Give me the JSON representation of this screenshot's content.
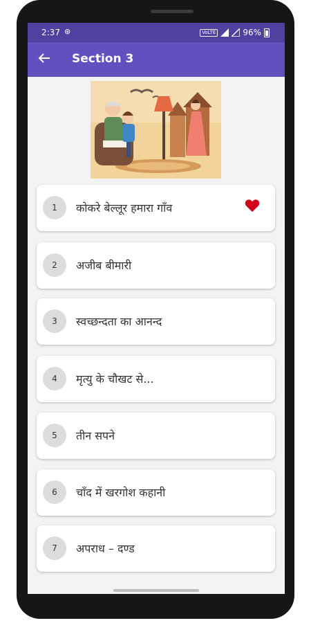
{
  "status_bar": {
    "time": "2:37",
    "sync_icon": "sync-icon",
    "network_label": "VoLTE",
    "battery": "96%"
  },
  "app_bar": {
    "back_icon": "arrow-left-icon",
    "title": "Section 3"
  },
  "colors": {
    "status_bar": "#5040a0",
    "app_bar": "#6250be",
    "favorite": "#d0021b"
  },
  "stories": [
    {
      "number": "1",
      "title": "कोकरे बेल्लूर हमारा गाँव",
      "favorite": true
    },
    {
      "number": "2",
      "title": "अजीब बीमारी",
      "favorite": false
    },
    {
      "number": "3",
      "title": "स्वच्छन्दता का आनन्द",
      "favorite": false
    },
    {
      "number": "4",
      "title": "मृत्यु के चौखट से...",
      "favorite": false
    },
    {
      "number": "5",
      "title": "तीन सपने",
      "favorite": false
    },
    {
      "number": "6",
      "title": "चाँद में खरगोश कहानी",
      "favorite": false
    },
    {
      "number": "7",
      "title": "अपराध – दण्ड",
      "favorite": false
    }
  ]
}
